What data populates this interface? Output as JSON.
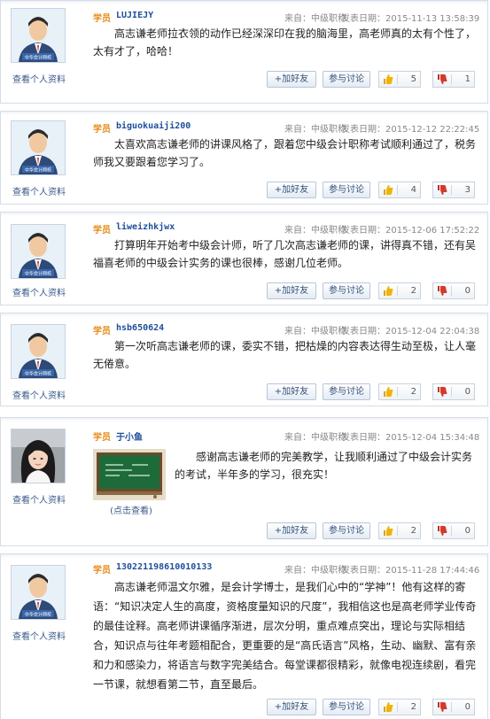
{
  "labels": {
    "add_friend": "+加好友",
    "join_discussion": "参与讨论",
    "view_profile": "查看个人资料",
    "avatar_badge": "中华会计网校",
    "image_caption": "(点击查看)"
  },
  "posts": [
    {
      "role": "学员",
      "username": "LUJIEJY",
      "source": "来自：中级职称",
      "date": "发表日期：2015-11-13 13:58:39",
      "content": "高志谦老师拉衣领的动作已经深深印在我的脑海里，高老师真的太有个性了，太有才了，哈哈！",
      "up": "5",
      "down": "1"
    },
    {
      "role": "学员",
      "username": "biguokuaiji200",
      "source": "来自：中级职称",
      "date": "发表日期：2015-12-12 22:22:45",
      "content": "太喜欢高志谦老师的讲课风格了，跟着您中级会计职称考试顺利通过了，税务师我又要跟着您学习了。",
      "up": "4",
      "down": "3"
    },
    {
      "role": "学员",
      "username": "liweizhkjwx",
      "source": "来自：中级职称",
      "date": "发表日期：2015-12-06 17:52:22",
      "content": "打算明年开始考中级会计师，听了几次高志谦老师的课，讲得真不错，还有吴福喜老师的中级会计实务的课也很棒，感谢几位老师。",
      "up": "2",
      "down": "0"
    },
    {
      "role": "学员",
      "username": "hsb650624",
      "source": "来自：中级职称",
      "date": "发表日期：2015-12-04 22:04:38",
      "content": "第一次听高志谦老师的课，委实不错，把枯燥的内容表达得生动至极，让人毫无倦意。",
      "up": "2",
      "down": "0"
    },
    {
      "role": "学员",
      "username": "于小鱼",
      "source": "来自：中级职称",
      "date": "发表日期：2015-12-04 15:34:48",
      "content": "感谢高志谦老师的完美教学，让我顺利通过了中级会计实务的考试，半年多的学习，很充实！",
      "up": "2",
      "down": "0"
    },
    {
      "role": "学员",
      "username": "130221198610010133",
      "source": "来自：中级职称",
      "date": "发表日期：2015-11-28 17:44:46",
      "content": "高志谦老师温文尔雅，是会计学博士，是我们心中的“学神”！他有这样的寄语：“知识决定人生的高度，资格度量知识的尺度”，我相信这也是高老师学业传奇的最佳诠释。高老师讲课循序渐进，层次分明，重点难点突出，理论与实际相结合，知识点与往年考题相配合，更重要的是“高氏语言”风格，生动、幽默、富有亲和力和感染力，将语言与数字完美结合。每堂课都很精彩，就像电视连续剧，看完一节课，就想看第二节，直至最后。",
      "up": "2",
      "down": "0"
    }
  ],
  "colors": {
    "role": "#e58a12",
    "username": "#1f4e9b",
    "link": "#3a5a8a",
    "thumb_up": "#f0b400",
    "thumb_down": "#d33a2c"
  }
}
